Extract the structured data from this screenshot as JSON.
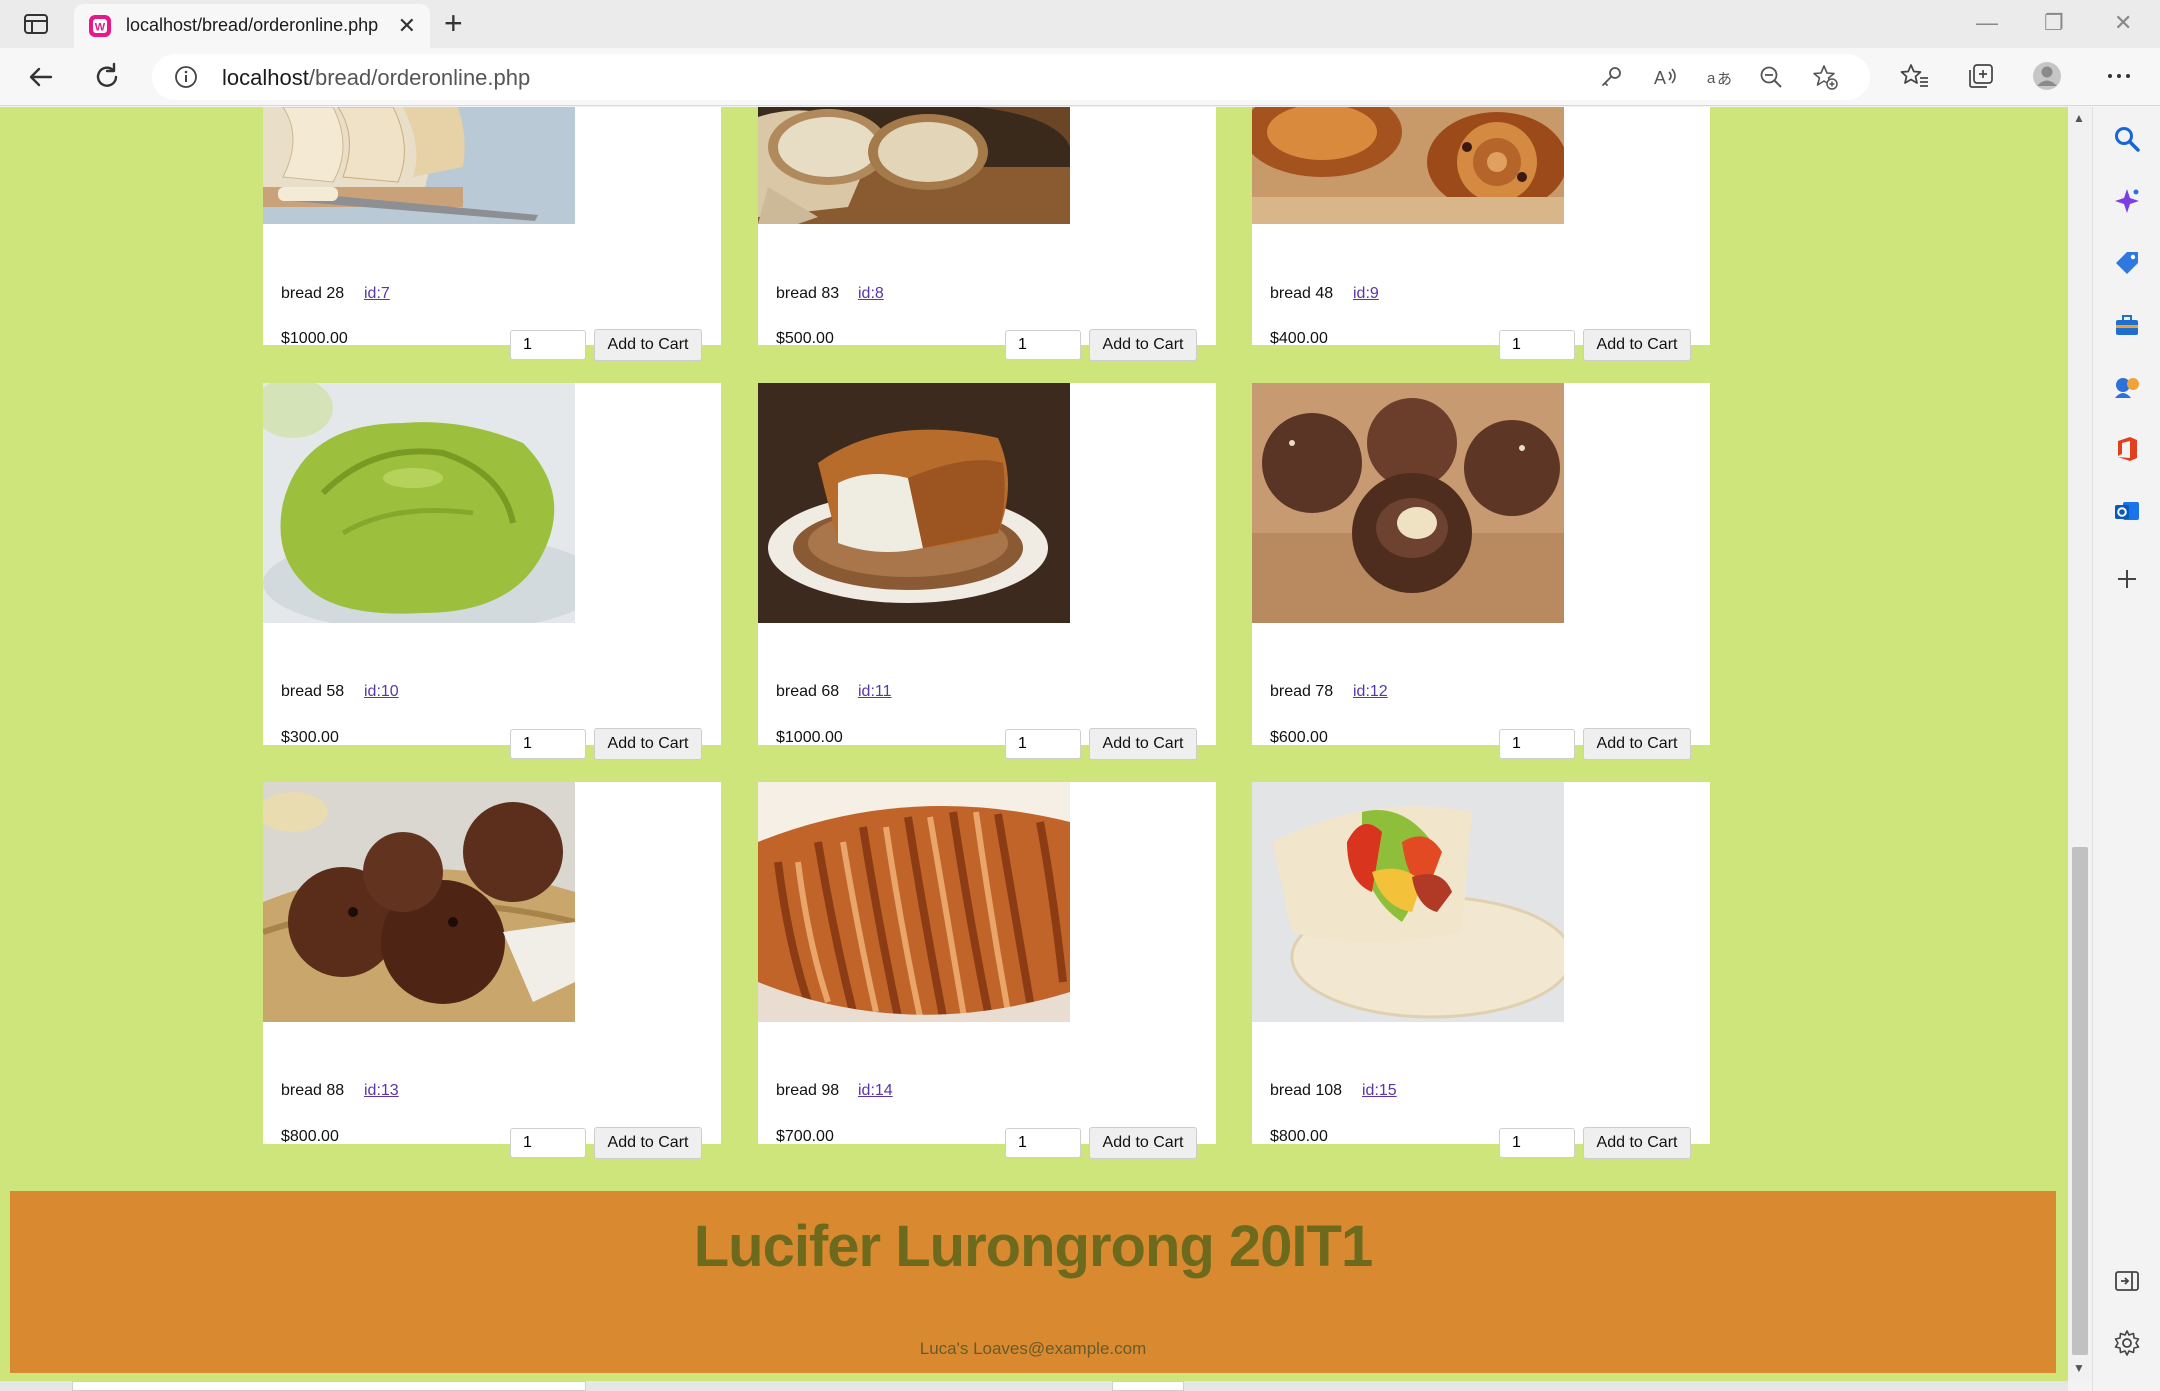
{
  "browser": {
    "tab_title": "localhost/bread/orderonline.php",
    "url_host": "localhost",
    "url_path": "/bread/orderonline.php",
    "close_glyph": "✕",
    "new_tab_glyph": "+",
    "minimize_glyph": "—",
    "maximize_glyph": "❐",
    "window_close_glyph": "✕"
  },
  "products": [
    {
      "name": "bread 28",
      "id_label": "id:7",
      "price": "$1000.00",
      "qty": "1",
      "button": "Add to Cart",
      "photo": "sliced-bread-on-board"
    },
    {
      "name": "bread 83",
      "id_label": "id:8",
      "price": "$500.00",
      "qty": "1",
      "button": "Add to Cart",
      "photo": "sourdough-loaf"
    },
    {
      "name": "bread 48",
      "id_label": "id:9",
      "price": "$400.00",
      "qty": "1",
      "button": "Add to Cart",
      "photo": "danish-pastries"
    },
    {
      "name": "bread 58",
      "id_label": "id:10",
      "price": "$300.00",
      "qty": "1",
      "button": "Add to Cart",
      "photo": "green-matcha-bun"
    },
    {
      "name": "bread 68",
      "id_label": "id:11",
      "price": "$1000.00",
      "qty": "1",
      "button": "Add to Cart",
      "photo": "white-loaf-on-plate"
    },
    {
      "name": "bread 78",
      "id_label": "id:12",
      "price": "$600.00",
      "qty": "1",
      "button": "Add to Cart",
      "photo": "chocolate-rolls"
    },
    {
      "name": "bread 88",
      "id_label": "id:13",
      "price": "$800.00",
      "qty": "1",
      "button": "Add to Cart",
      "photo": "raisin-buns-in-basket"
    },
    {
      "name": "bread 98",
      "id_label": "id:14",
      "price": "$700.00",
      "qty": "1",
      "button": "Add to Cart",
      "photo": "sliced-brioche"
    },
    {
      "name": "bread 108",
      "id_label": "id:15",
      "price": "$800.00",
      "qty": "1",
      "button": "Add to Cart",
      "photo": "pita-wrap"
    }
  ],
  "footer": {
    "title": "Lucifer Lurongrong 20IT1",
    "email": "Luca's Loaves@example.com"
  },
  "colors": {
    "page_bg": "#cde57a",
    "footer_bg": "#d98a30",
    "footer_title": "#6d6a1e",
    "link": "#5a35a8"
  }
}
